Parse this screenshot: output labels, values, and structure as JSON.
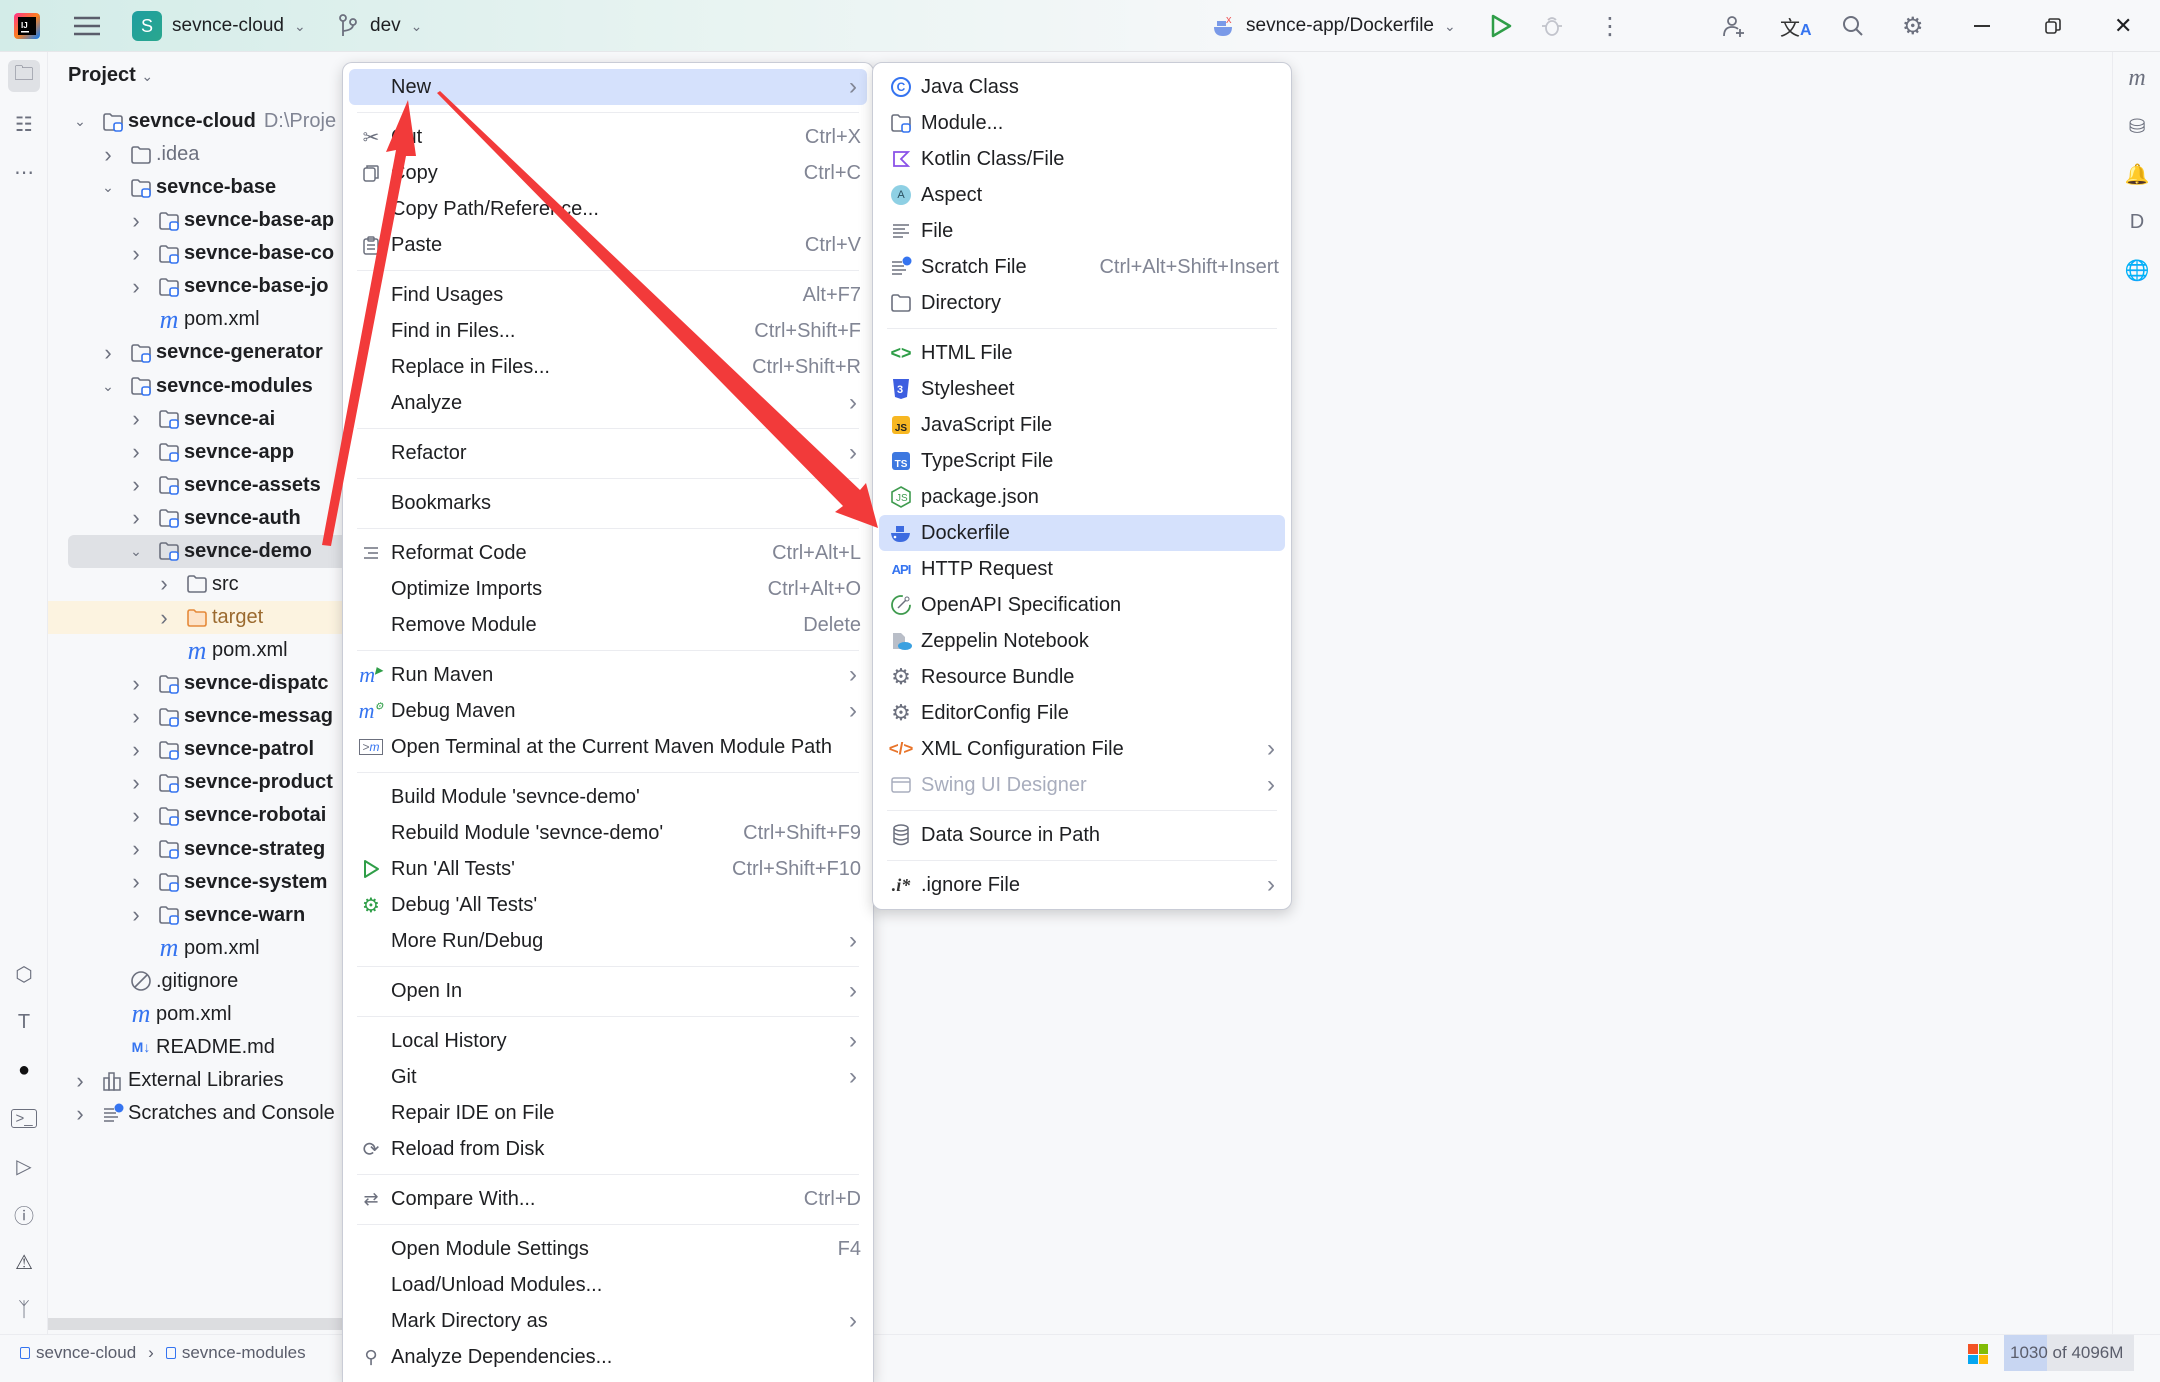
{
  "titlebar": {
    "project_badge": "S",
    "project_name": "sevnce-cloud",
    "branch": "dev",
    "run_config": "sevnce-app/Dockerfile"
  },
  "project_panel": {
    "title": "Project",
    "tree": [
      {
        "label": "sevnce-cloud",
        "path": "D:\\Proje",
        "level": 0,
        "chevron": "down",
        "icon": "module-folder",
        "bold": true
      },
      {
        "label": ".idea",
        "level": 1,
        "chevron": "right",
        "icon": "folder",
        "muted": true
      },
      {
        "label": "sevnce-base",
        "level": 1,
        "chevron": "down",
        "icon": "module-folder",
        "bold": true
      },
      {
        "label": "sevnce-base-ap",
        "level": 2,
        "chevron": "right",
        "icon": "module-folder",
        "bold": true
      },
      {
        "label": "sevnce-base-co",
        "level": 2,
        "chevron": "right",
        "icon": "module-folder",
        "bold": true
      },
      {
        "label": "sevnce-base-jo",
        "level": 2,
        "chevron": "right",
        "icon": "module-folder",
        "bold": true
      },
      {
        "label": "pom.xml",
        "level": 2,
        "icon": "maven"
      },
      {
        "label": "sevnce-generator",
        "level": 1,
        "chevron": "right",
        "icon": "module-folder",
        "bold": true
      },
      {
        "label": "sevnce-modules",
        "level": 1,
        "chevron": "down",
        "icon": "module-folder",
        "bold": true
      },
      {
        "label": "sevnce-ai",
        "level": 2,
        "chevron": "right",
        "icon": "module-folder",
        "bold": true
      },
      {
        "label": "sevnce-app",
        "level": 2,
        "chevron": "right",
        "icon": "module-folder",
        "bold": true
      },
      {
        "label": "sevnce-assets",
        "level": 2,
        "chevron": "right",
        "icon": "module-folder",
        "bold": true
      },
      {
        "label": "sevnce-auth",
        "level": 2,
        "chevron": "right",
        "icon": "module-folder",
        "bold": true
      },
      {
        "label": "sevnce-demo",
        "level": 2,
        "chevron": "down",
        "icon": "module-folder",
        "bold": true,
        "selected": true
      },
      {
        "label": "src",
        "level": 3,
        "chevron": "right",
        "icon": "folder"
      },
      {
        "label": "target",
        "level": 3,
        "chevron": "right",
        "icon": "excluded-folder",
        "excluded": true
      },
      {
        "label": "pom.xml",
        "level": 3,
        "icon": "maven"
      },
      {
        "label": "sevnce-dispatc",
        "level": 2,
        "chevron": "right",
        "icon": "module-folder",
        "bold": true
      },
      {
        "label": "sevnce-messag",
        "level": 2,
        "chevron": "right",
        "icon": "module-folder",
        "bold": true
      },
      {
        "label": "sevnce-patrol",
        "level": 2,
        "chevron": "right",
        "icon": "module-folder",
        "bold": true
      },
      {
        "label": "sevnce-product",
        "level": 2,
        "chevron": "right",
        "icon": "module-folder",
        "bold": true
      },
      {
        "label": "sevnce-robotai",
        "level": 2,
        "chevron": "right",
        "icon": "module-folder",
        "bold": true
      },
      {
        "label": "sevnce-strateg",
        "level": 2,
        "chevron": "right",
        "icon": "module-folder",
        "bold": true
      },
      {
        "label": "sevnce-system",
        "level": 2,
        "chevron": "right",
        "icon": "module-folder",
        "bold": true
      },
      {
        "label": "sevnce-warn",
        "level": 2,
        "chevron": "right",
        "icon": "module-folder",
        "bold": true
      },
      {
        "label": "pom.xml",
        "level": 2,
        "icon": "maven"
      },
      {
        "label": ".gitignore",
        "level": 1,
        "icon": "ignore"
      },
      {
        "label": "pom.xml",
        "level": 1,
        "icon": "maven"
      },
      {
        "label": "README.md",
        "level": 1,
        "icon": "markdown"
      },
      {
        "label": "External Libraries",
        "level": 0,
        "chevron": "right",
        "icon": "library"
      },
      {
        "label": "Scratches and Console",
        "level": 0,
        "chevron": "right",
        "icon": "scratch"
      }
    ]
  },
  "context_menu": {
    "groups": [
      [
        {
          "label": "New",
          "submenu": true,
          "highlighted": true
        }
      ],
      [
        {
          "label": "Cut",
          "shortcut": "Ctrl+X",
          "icon": "scissors"
        },
        {
          "label": "Copy",
          "shortcut": "Ctrl+C",
          "icon": "copy"
        },
        {
          "label": "Copy Path/Reference..."
        },
        {
          "label": "Paste",
          "shortcut": "Ctrl+V",
          "icon": "paste"
        }
      ],
      [
        {
          "label": "Find Usages",
          "shortcut": "Alt+F7"
        },
        {
          "label": "Find in Files...",
          "shortcut": "Ctrl+Shift+F"
        },
        {
          "label": "Replace in Files...",
          "shortcut": "Ctrl+Shift+R"
        },
        {
          "label": "Analyze",
          "submenu": true
        }
      ],
      [
        {
          "label": "Refactor",
          "submenu": true
        }
      ],
      [
        {
          "label": "Bookmarks",
          "submenu": true
        }
      ],
      [
        {
          "label": "Reformat Code",
          "shortcut": "Ctrl+Alt+L",
          "icon": "reformat"
        },
        {
          "label": "Optimize Imports",
          "shortcut": "Ctrl+Alt+O"
        },
        {
          "label": "Remove Module",
          "shortcut": "Delete"
        }
      ],
      [
        {
          "label": "Run Maven",
          "submenu": true,
          "icon": "maven-run"
        },
        {
          "label": "Debug Maven",
          "submenu": true,
          "icon": "maven-debug"
        },
        {
          "label": "Open Terminal at the Current Maven Module Path",
          "icon": "maven-terminal"
        }
      ],
      [
        {
          "label": "Build Module 'sevnce-demo'"
        },
        {
          "label": "Rebuild Module 'sevnce-demo'",
          "shortcut": "Ctrl+Shift+F9"
        },
        {
          "label": "Run 'All Tests'",
          "shortcut": "Ctrl+Shift+F10",
          "icon": "run"
        },
        {
          "label": "Debug 'All Tests'",
          "icon": "debug"
        },
        {
          "label": "More Run/Debug",
          "submenu": true
        }
      ],
      [
        {
          "label": "Open In",
          "submenu": true
        }
      ],
      [
        {
          "label": "Local History",
          "submenu": true
        },
        {
          "label": "Git",
          "submenu": true
        },
        {
          "label": "Repair IDE on File"
        },
        {
          "label": "Reload from Disk",
          "icon": "reload"
        }
      ],
      [
        {
          "label": "Compare With...",
          "shortcut": "Ctrl+D",
          "icon": "compare"
        }
      ],
      [
        {
          "label": "Open Module Settings",
          "shortcut": "F4"
        },
        {
          "label": "Load/Unload Modules..."
        },
        {
          "label": "Mark Directory as",
          "submenu": true
        },
        {
          "label": "Analyze Dependencies...",
          "icon": "analyze-deps"
        }
      ]
    ]
  },
  "new_submenu": {
    "groups": [
      [
        {
          "label": "Java Class",
          "icon": "java-class"
        },
        {
          "label": "Module...",
          "icon": "module"
        },
        {
          "label": "Kotlin Class/File",
          "icon": "kotlin"
        },
        {
          "label": "Aspect",
          "icon": "aspect"
        },
        {
          "label": "File",
          "icon": "file"
        },
        {
          "label": "Scratch File",
          "shortcut": "Ctrl+Alt+Shift+Insert",
          "icon": "scratch"
        },
        {
          "label": "Directory",
          "icon": "folder"
        }
      ],
      [
        {
          "label": "HTML File",
          "icon": "html"
        },
        {
          "label": "Stylesheet",
          "icon": "css"
        },
        {
          "label": "JavaScript File",
          "icon": "js"
        },
        {
          "label": "TypeScript File",
          "icon": "ts"
        },
        {
          "label": "package.json",
          "icon": "nodejs"
        },
        {
          "label": "Dockerfile",
          "icon": "docker",
          "highlighted": true
        },
        {
          "label": "HTTP Request",
          "icon": "api"
        },
        {
          "label": "OpenAPI Specification",
          "icon": "openapi"
        },
        {
          "label": "Zeppelin Notebook",
          "icon": "zeppelin"
        },
        {
          "label": "Resource Bundle",
          "icon": "gear"
        },
        {
          "label": "EditorConfig File",
          "icon": "gear"
        },
        {
          "label": "XML Configuration File",
          "icon": "xml",
          "submenu": true
        },
        {
          "label": "Swing UI Designer",
          "icon": "swing",
          "submenu": true,
          "disabled": true
        }
      ],
      [
        {
          "label": "Data Source in Path",
          "icon": "database"
        }
      ],
      [
        {
          "label": ".ignore File",
          "icon": "ignore-file",
          "submenu": true
        }
      ]
    ]
  },
  "statusbar": {
    "breadcrumb": [
      "sevnce-cloud",
      "sevnce-modules"
    ],
    "memory": "1030 of 4096M"
  },
  "annotation_color": "#f23a3a",
  "accent_color": "#3574f0"
}
